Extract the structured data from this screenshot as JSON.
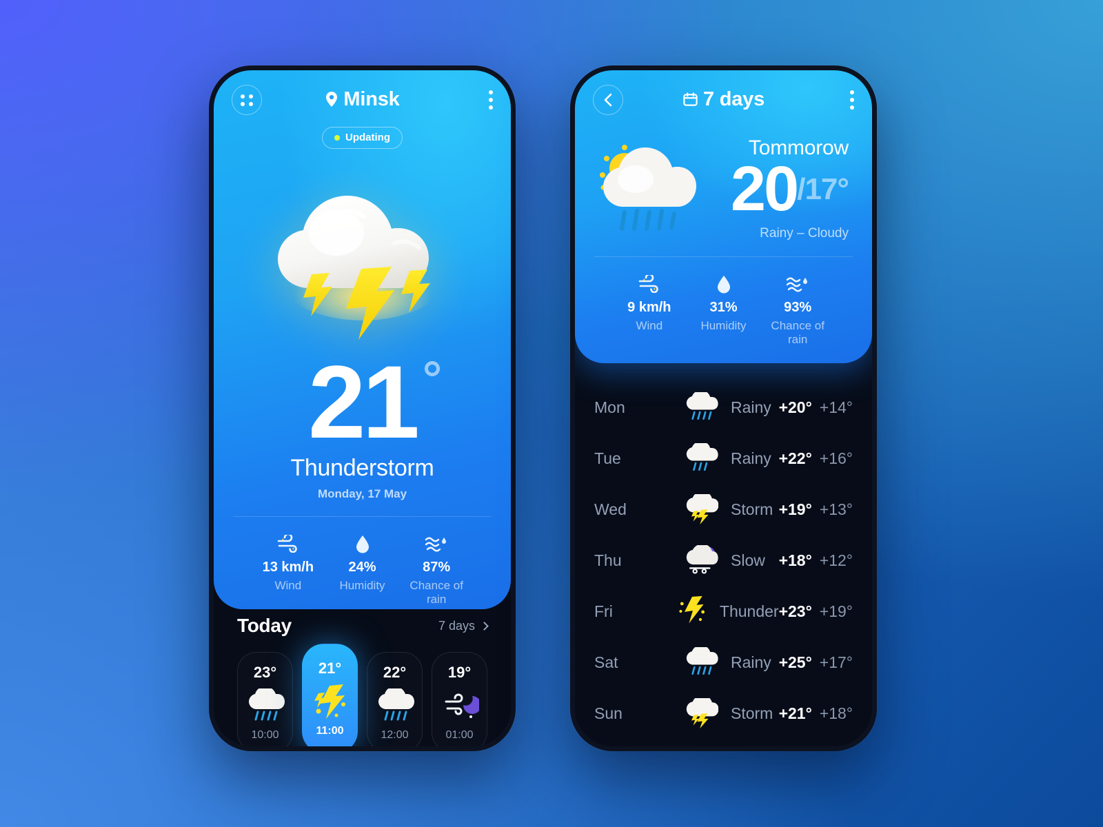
{
  "app": {
    "accent_blue": "#1ea2f4",
    "dark_bg": "#070c18",
    "badge_dot": "#dcff3c"
  },
  "left_screen": {
    "grid_icon": "grid-dots-icon",
    "location_icon": "location-pin-icon",
    "city": "Minsk",
    "menu_icon": "kebab-menu-icon",
    "status_badge": "Updating",
    "hero_icon": "thunderstorm-cloud-icon",
    "temperature": "21",
    "degree_symbol": "°",
    "condition": "Thunderstorm",
    "date": "Monday, 17 May",
    "metrics": [
      {
        "icon": "wind-icon",
        "value": "13 km/h",
        "label": "Wind"
      },
      {
        "icon": "humidity-drop-icon",
        "value": "24%",
        "label": "Humidity"
      },
      {
        "icon": "rain-waves-icon",
        "value": "87%",
        "label": "Chance of rain"
      }
    ],
    "today_title": "Today",
    "seven_days_link": "7 days",
    "hours": [
      {
        "temp": "23°",
        "icon": "sun-rain-cloud-icon",
        "time": "10:00",
        "selected": false
      },
      {
        "temp": "21°",
        "icon": "lightning-bolt-icon",
        "time": "11:00",
        "selected": true
      },
      {
        "temp": "22°",
        "icon": "sun-rain-cloud-icon",
        "time": "12:00",
        "selected": false
      },
      {
        "temp": "19°",
        "icon": "night-wind-moon-icon",
        "time": "01:00",
        "selected": false
      }
    ]
  },
  "right_screen": {
    "back_icon": "chevron-left-icon",
    "calendar_icon": "calendar-icon",
    "title": "7 days",
    "menu_icon": "kebab-menu-icon",
    "tomorrow": {
      "icon": "sun-rain-cloud-icon",
      "label": "Tommorow",
      "high": "20",
      "low": "/17°",
      "description": "Rainy – Cloudy",
      "metrics": [
        {
          "icon": "wind-icon",
          "value": "9 km/h",
          "label": "Wind"
        },
        {
          "icon": "humidity-drop-icon",
          "value": "31%",
          "label": "Humidity"
        },
        {
          "icon": "rain-waves-icon",
          "value": "93%",
          "label": "Chance of rain"
        }
      ]
    },
    "forecast": [
      {
        "day": "Mon",
        "icon": "sun-rain-cloud-icon",
        "condition": "Rainy",
        "high": "+20°",
        "low": "+14°"
      },
      {
        "day": "Tue",
        "icon": "sun-rain-cloud-icon",
        "condition": "Rainy",
        "high": "+22°",
        "low": "+16°"
      },
      {
        "day": "Wed",
        "icon": "storm-cloud-icon",
        "condition": "Storm",
        "high": "+19°",
        "low": "+13°"
      },
      {
        "day": "Thu",
        "icon": "night-snow-icon",
        "condition": "Slow",
        "high": "+18°",
        "low": "+12°"
      },
      {
        "day": "Fri",
        "icon": "lightning-bolt-icon",
        "condition": "Thunder",
        "high": "+23°",
        "low": "+19°"
      },
      {
        "day": "Sat",
        "icon": "sun-rain-cloud-icon",
        "condition": "Rainy",
        "high": "+25°",
        "low": "+17°"
      },
      {
        "day": "Sun",
        "icon": "storm-cloud-icon",
        "condition": "Storm",
        "high": "+21°",
        "low": "+18°"
      }
    ]
  }
}
